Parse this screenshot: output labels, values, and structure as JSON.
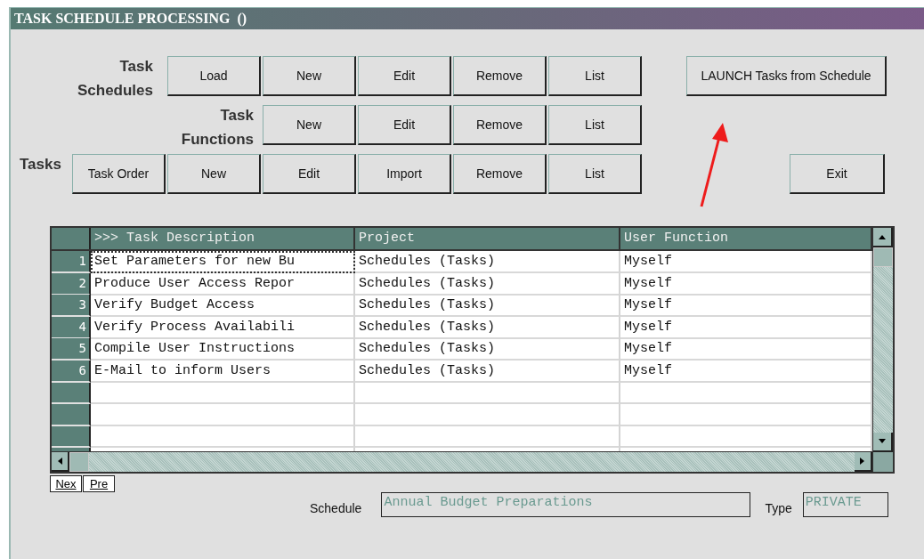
{
  "window": {
    "title": "TASK SCHEDULE PROCESSING  ()"
  },
  "button_rows": [
    {
      "label": "Task Schedules",
      "buttons": [
        "Load",
        "New",
        "Edit",
        "Remove",
        "List"
      ]
    },
    {
      "label": "Task Functions",
      "buttons": [
        "New",
        "Edit",
        "Remove",
        "List"
      ]
    },
    {
      "label": "Tasks",
      "buttons": [
        "Task Order",
        "New",
        "Edit",
        "Import",
        "Remove",
        "List"
      ]
    }
  ],
  "launch_button": "LAUNCH Tasks from Schedule",
  "exit_button": "Exit",
  "table": {
    "columns": [
      ">>> Task Description",
      "Project",
      "User Function"
    ],
    "rows": [
      {
        "number": "1",
        "cells": [
          "Set Parameters for new Bu",
          "Schedules (Tasks)",
          "Myself"
        ],
        "focused": true
      },
      {
        "number": "2",
        "cells": [
          "Produce User Access Repor",
          "Schedules (Tasks)",
          "Myself"
        ],
        "focused": false
      },
      {
        "number": "3",
        "cells": [
          "Verify Budget Access",
          "Schedules (Tasks)",
          "Myself"
        ],
        "focused": false
      },
      {
        "number": "4",
        "cells": [
          "Verify Process Availabili",
          "Schedules (Tasks)",
          "Myself"
        ],
        "focused": false
      },
      {
        "number": "5",
        "cells": [
          "Compile User Instructions",
          "Schedules (Tasks)",
          "Myself"
        ],
        "focused": false
      },
      {
        "number": "6",
        "cells": [
          "E-Mail to inform Users",
          "Schedules (Tasks)",
          "Myself"
        ],
        "focused": false
      }
    ]
  },
  "nav_buttons": [
    "Nex",
    "Pre"
  ],
  "schedule": {
    "label": "Schedule",
    "value": "Annual Budget Preparations"
  },
  "type": {
    "label": "Type",
    "value": "PRIVATE"
  }
}
